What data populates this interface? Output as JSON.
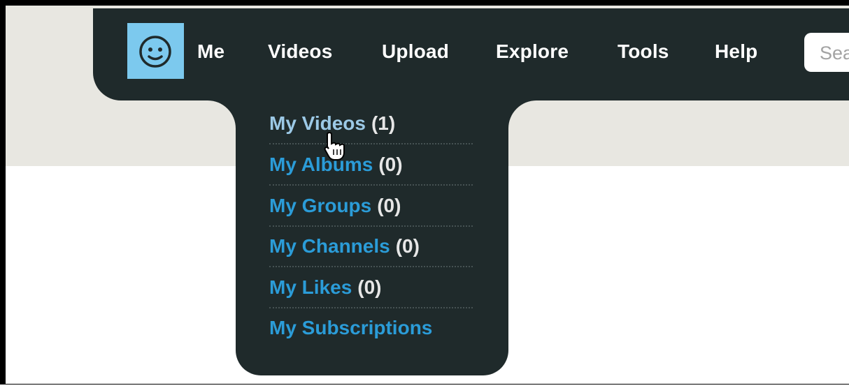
{
  "nav": {
    "items": [
      "Me",
      "Videos",
      "Upload",
      "Explore",
      "Tools",
      "Help"
    ],
    "search_placeholder": "Search"
  },
  "dropdown": {
    "items": [
      {
        "label": "My Videos",
        "count": "(1)"
      },
      {
        "label": "My Albums",
        "count": "(0)"
      },
      {
        "label": "My Groups",
        "count": "(0)"
      },
      {
        "label": "My Channels",
        "count": "(0)"
      },
      {
        "label": "My Likes",
        "count": "(0)"
      },
      {
        "label": "My Subscriptions",
        "count": ""
      }
    ]
  },
  "icons": {
    "avatar": "smiley-face-icon",
    "cursor": "hand-pointer-icon"
  },
  "colors": {
    "navbar_bg": "#1f2a2b",
    "avatar_bg": "#7cc9ee",
    "link_blue": "#2b9cd8",
    "link_hover": "#9cc9e6",
    "page_band": "#e8e7e1"
  }
}
